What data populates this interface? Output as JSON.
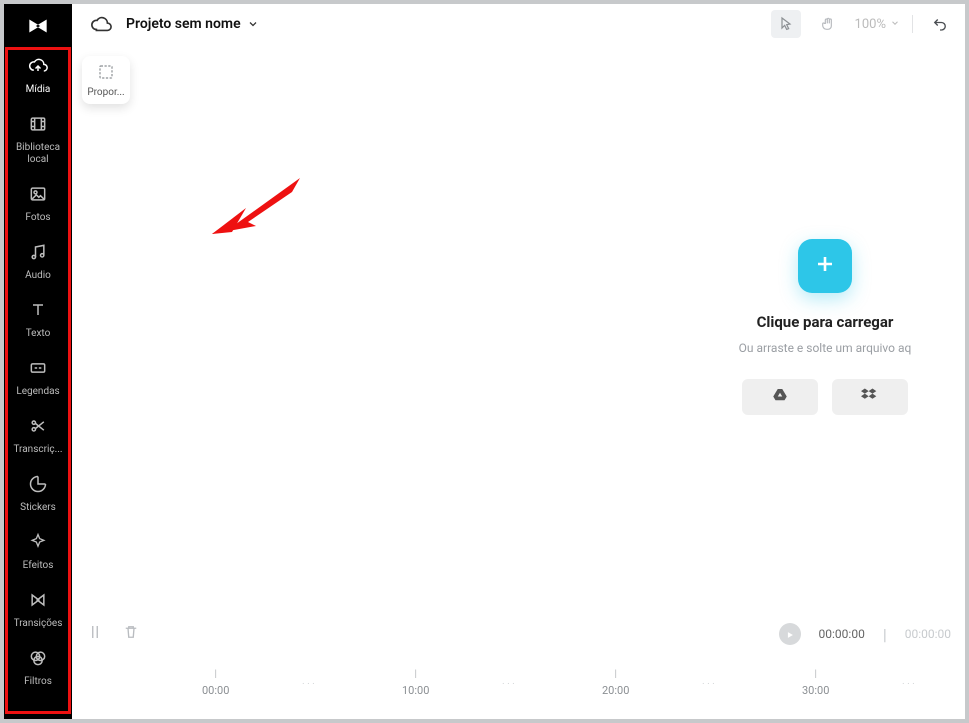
{
  "header": {
    "project_name": "Projeto sem nome",
    "zoom_label": "100%"
  },
  "sidebar": {
    "items": [
      {
        "label": "Mídia"
      },
      {
        "label": "Biblioteca local"
      },
      {
        "label": "Fotos"
      },
      {
        "label": "Áudio"
      },
      {
        "label": "Texto"
      },
      {
        "label": "Legendas"
      },
      {
        "label": "Transcriç..."
      },
      {
        "label": "Stickers"
      },
      {
        "label": "Efeitos"
      },
      {
        "label": "Transições"
      },
      {
        "label": "Filtros"
      }
    ]
  },
  "canvas": {
    "ratio_chip_label": "Propor...",
    "upload_title": "Clique para carregar",
    "upload_subtitle": "Ou arraste e solte um arquivo aq"
  },
  "timeline": {
    "current_time": "00:00:00",
    "duration": "00:00:00",
    "ticks": [
      "00:00",
      "10:00",
      "20:00",
      "30:00"
    ]
  },
  "colors": {
    "accent_cyan": "#2dc6e8",
    "highlight_red": "#e11"
  }
}
